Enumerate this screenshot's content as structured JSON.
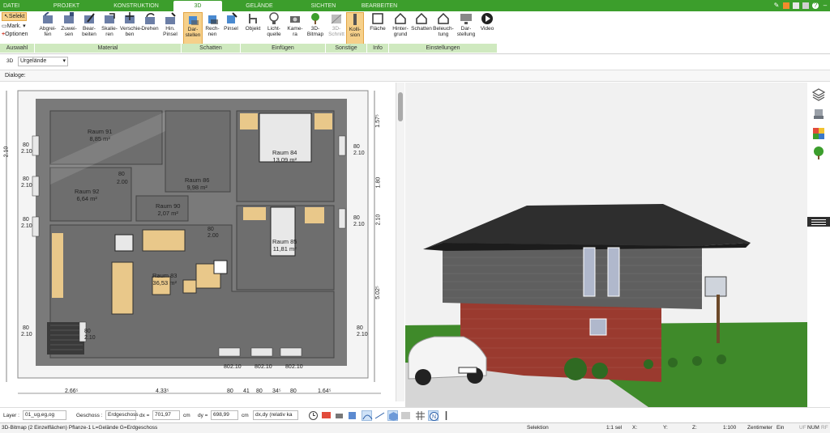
{
  "tabs": [
    {
      "label": "DATEI"
    },
    {
      "label": "PROJEKT"
    },
    {
      "label": "KONSTRUKTION"
    },
    {
      "label": "3D"
    },
    {
      "label": "GELÄNDE"
    },
    {
      "label": "SICHTEN"
    },
    {
      "label": "BEARBEITEN"
    }
  ],
  "accent": "#3c9e2c",
  "ribbon": {
    "auswahl": {
      "selekt": "Selekt",
      "mark": "Mark.",
      "optionen": "Optionen",
      "group": "Auswahl"
    },
    "material": {
      "group": "Material",
      "buttons": [
        "Abgrei-\nfen",
        "Zuwei-\nsen",
        "Bear-\nbeiten",
        "Skalie-\nren",
        "Verschie-\nben",
        "Drehen",
        "Hin.\nPinsel"
      ]
    },
    "schatten": {
      "group": "Schatten",
      "buttons": [
        "Dar-\nstellen",
        "Rech-\nnen",
        "Pinsel"
      ]
    },
    "einfuegen": {
      "group": "Einfügen",
      "buttons": [
        "Objekt",
        "Licht-\nquelle",
        "Kame-\nra",
        "3D-\nBitmap"
      ]
    },
    "sonstige": {
      "group": "Sonstige",
      "buttons": [
        "3D-\nSchnitt",
        "Kolli-\nsion"
      ]
    },
    "info": {
      "group": "Info",
      "buttons": [
        "Fläche"
      ]
    },
    "einstellungen": {
      "group": "Einstellungen",
      "buttons": [
        "Hinter-\ngrund",
        "Schatten",
        "Beleuch-\ntung",
        "Dar-\nstellung",
        "Video"
      ]
    }
  },
  "toolrow": {
    "view": "3D",
    "terrain": "Urgelände"
  },
  "dialoge": "Dialoge:",
  "rooms": [
    {
      "name": "Raum 91",
      "area": "8,85 m²"
    },
    {
      "name": "Raum 92",
      "area": "6,64 m²"
    },
    {
      "name": "Raum 90",
      "area": "2,07 m²"
    },
    {
      "name": "Raum 86",
      "area": "9,98 m²"
    },
    {
      "name": "Raum 84",
      "area": "13,09 m²"
    },
    {
      "name": "Raum 85",
      "area": "11,81 m²"
    },
    {
      "name": "Raum 83",
      "area": "36,53 m²"
    }
  ],
  "dims": {
    "left": [
      "80",
      "2.10",
      "2.10",
      "80",
      "2.10",
      "80",
      "2.10",
      "80",
      "2.10"
    ],
    "right": [
      "80",
      "2.10",
      "80",
      "2.10",
      "80",
      "2.10"
    ],
    "rightouter": [
      "1.57⁵",
      "1.80",
      "2.10",
      "5.02⁵"
    ],
    "bottom": [
      "2.66⁵",
      "4.33⁵",
      "80",
      "41",
      "80",
      "34⁵",
      "80",
      "1.64⁵"
    ],
    "inner": [
      "80",
      "2.00",
      "80",
      "2.00",
      "80",
      "2.10",
      "80",
      "2.10",
      "80",
      "2.10",
      "80",
      "2.10"
    ]
  },
  "bottombar": {
    "layer_label": "Layer :",
    "layer": "01_ug,eg,og",
    "geschoss_label": "Geschoss :",
    "geschoss": "Erdgeschoss",
    "dx_label": "dx =",
    "dx": "701,97",
    "dx_unit": "cm",
    "dy_label": "dy =",
    "dy": "698,99",
    "dy_unit": "cm",
    "mode": "dx,dy (relativ ka"
  },
  "status": {
    "left": "3D-Bitmap (2 Einzelflächen) Pflanze-1 L=Gelände G=Erdgeschoss",
    "mode": "Selektion",
    "sel": "1:1 sel",
    "x": "X:",
    "y": "Y:",
    "z": "Z:",
    "scale": "1:100",
    "unit": "Zentimeter",
    "ein": "Ein",
    "uf": "UF",
    "num": "NUM",
    "rf": "RF"
  }
}
